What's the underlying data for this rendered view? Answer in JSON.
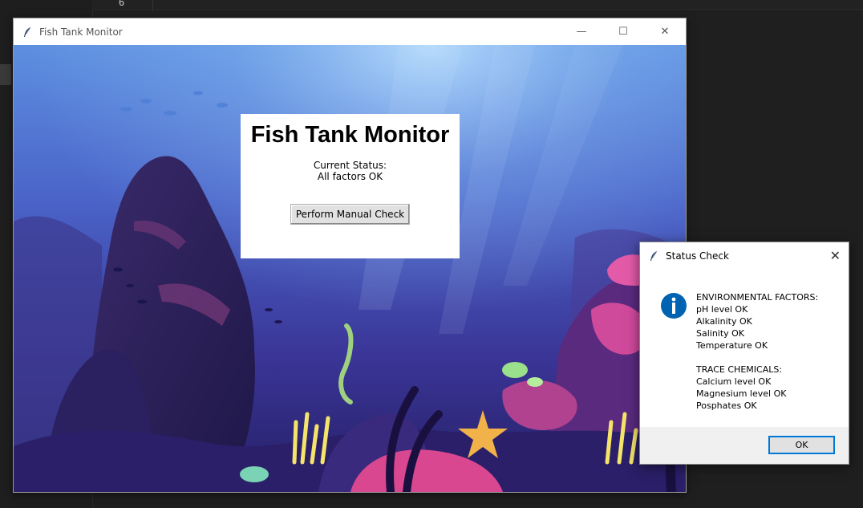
{
  "editor": {
    "line_number": "6"
  },
  "main_window": {
    "title": "Fish Tank Monitor",
    "controls": {
      "minimize": "—",
      "maximize": "☐",
      "close": "✕"
    },
    "panel": {
      "heading": "Fish Tank Monitor",
      "status_label": "Current Status:",
      "status_value": "All factors OK",
      "manual_check_label": "Perform Manual Check"
    },
    "background": "underwater-coral-reef-illustration"
  },
  "dialog": {
    "title": "Status Check",
    "close": "✕",
    "icon": "info-icon",
    "lines": [
      "ENVIRONMENTAL FACTORS:",
      "pH level OK",
      "Alkalinity OK",
      "Salinity OK",
      "Temperature OK",
      "",
      "TRACE CHEMICALS:",
      "Calcium level OK",
      "Magnesium level OK",
      "Posphates OK"
    ],
    "ok_label": "OK"
  },
  "colors": {
    "accent": "#0078d7",
    "info_icon": "#0063b1",
    "water_top": "#6ea5ea",
    "water_deep": "#2a2580"
  }
}
